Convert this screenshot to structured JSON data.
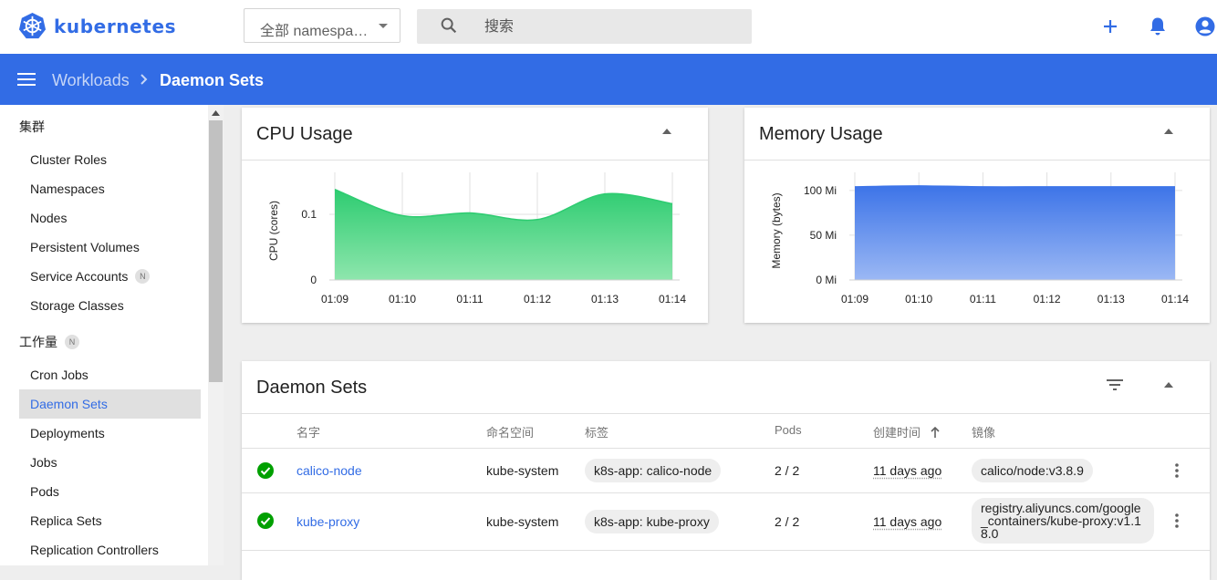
{
  "app": {
    "name": "kubernetes"
  },
  "header": {
    "namespace_select": "全部 namespaces",
    "search_placeholder": "搜索"
  },
  "breadcrumb": {
    "parent": "Workloads",
    "current": "Daemon Sets"
  },
  "sidebar": {
    "cluster_header": "集群",
    "cluster_items": [
      {
        "label": "Cluster Roles"
      },
      {
        "label": "Namespaces"
      },
      {
        "label": "Nodes"
      },
      {
        "label": "Persistent Volumes"
      },
      {
        "label": "Service Accounts",
        "badge": "N"
      },
      {
        "label": "Storage Classes"
      }
    ],
    "workloads_header": "工作量",
    "workloads_badge": "N",
    "workload_items": [
      {
        "label": "Cron Jobs"
      },
      {
        "label": "Daemon Sets",
        "active": true
      },
      {
        "label": "Deployments"
      },
      {
        "label": "Jobs"
      },
      {
        "label": "Pods"
      },
      {
        "label": "Replica Sets"
      },
      {
        "label": "Replication Controllers"
      }
    ]
  },
  "cpu_card": {
    "title": "CPU Usage"
  },
  "memory_card": {
    "title": "Memory Usage"
  },
  "chart_data": [
    {
      "type": "area",
      "title": "CPU Usage",
      "xlabel": "",
      "ylabel": "CPU (cores)",
      "x": [
        "01:09",
        "01:10",
        "01:11",
        "01:12",
        "01:13",
        "01:14"
      ],
      "y_ticks": [
        "0",
        "0.1"
      ],
      "ylim": [
        0,
        0.15
      ],
      "values": [
        0.138,
        0.098,
        0.102,
        0.092,
        0.131,
        0.116
      ],
      "color": "#2ecc71",
      "grid": true
    },
    {
      "type": "area",
      "title": "Memory Usage",
      "xlabel": "",
      "ylabel": "Memory (bytes)",
      "x": [
        "01:09",
        "01:10",
        "01:11",
        "01:12",
        "01:13",
        "01:14"
      ],
      "y_ticks": [
        "0 Mi",
        "50 Mi",
        "100 Mi"
      ],
      "ylim": [
        0,
        110
      ],
      "values": [
        104,
        105,
        104,
        104,
        104,
        104
      ],
      "color": "#326ce5",
      "grid": true
    }
  ],
  "table": {
    "title": "Daemon Sets",
    "columns": [
      "名字",
      "命名空间",
      "标签",
      "Pods",
      "创建时间",
      "镜像"
    ],
    "rows": [
      {
        "status": "ok",
        "name": "calico-node",
        "namespace": "kube-system",
        "labels": "k8s-app: calico-node",
        "pods": "2 / 2",
        "created": "11 days ago",
        "image": "calico/node:v3.8.9"
      },
      {
        "status": "ok",
        "name": "kube-proxy",
        "namespace": "kube-system",
        "labels": "k8s-app: kube-proxy",
        "pods": "2 / 2",
        "created": "11 days ago",
        "image": "registry.aliyuncs.com/google_containers/kube-proxy:v1.18.0"
      }
    ]
  },
  "colors": {
    "brand": "#326ce5",
    "success": "#00a000",
    "cpu": "#2ecc71",
    "memory": "#326ce5"
  }
}
